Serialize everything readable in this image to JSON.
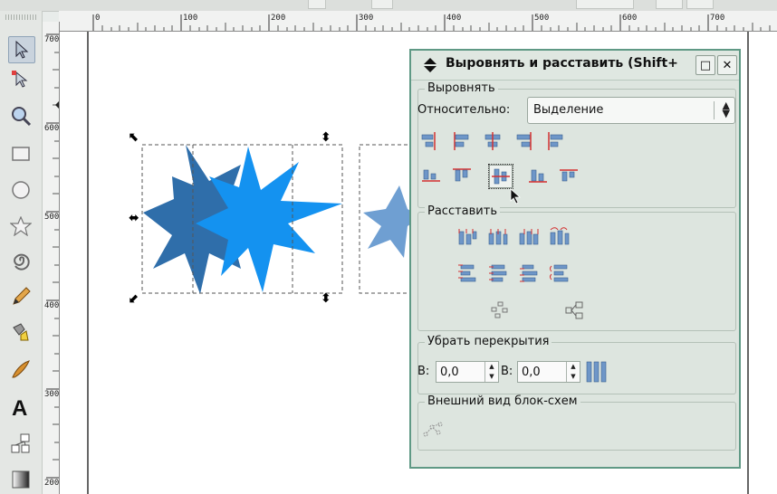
{
  "toolbox": {
    "tools": [
      {
        "name": "select-tool-icon"
      },
      {
        "name": "node-tool-icon"
      },
      {
        "name": "zoom-tool-icon"
      },
      {
        "name": "rectangle-tool-icon"
      },
      {
        "name": "ellipse-tool-icon"
      },
      {
        "name": "star-tool-icon"
      },
      {
        "name": "spiral-tool-icon"
      },
      {
        "name": "pencil-tool-icon"
      },
      {
        "name": "pen-tool-icon"
      },
      {
        "name": "calligraphy-tool-icon"
      },
      {
        "name": "text-tool-icon"
      },
      {
        "name": "connector-tool-icon"
      },
      {
        "name": "gradient-tool-icon"
      }
    ]
  },
  "ruler": {
    "h_labels": [
      "0",
      "100",
      "200",
      "300",
      "400",
      "500",
      "600",
      "700"
    ],
    "v_labels": [
      "700",
      "600",
      "500",
      "400",
      "300",
      "200"
    ]
  },
  "dialog": {
    "title": "Выровнять и расставить (Shift+",
    "minimize_label": "□",
    "close_label": "✕",
    "align": {
      "legend": "Выровнять",
      "relative_label": "Относительно:",
      "relative_value": "Выделение"
    },
    "distribute": {
      "legend": "Расставить"
    },
    "remove_overlaps": {
      "legend": "Убрать перекрытия",
      "h_label": "В:",
      "h_value": "0,0",
      "v_label": "В:",
      "v_value": "0,0"
    },
    "connectors": {
      "legend": "Внешний вид блок-схем"
    }
  },
  "colors": {
    "star_dark": "#2f6eaa",
    "star_bright": "#1492f0",
    "star_pale": "#6f9fd2",
    "dialog_border": "#5f9985",
    "icon_bar": "#6e96c8",
    "icon_line": "#d43030"
  }
}
